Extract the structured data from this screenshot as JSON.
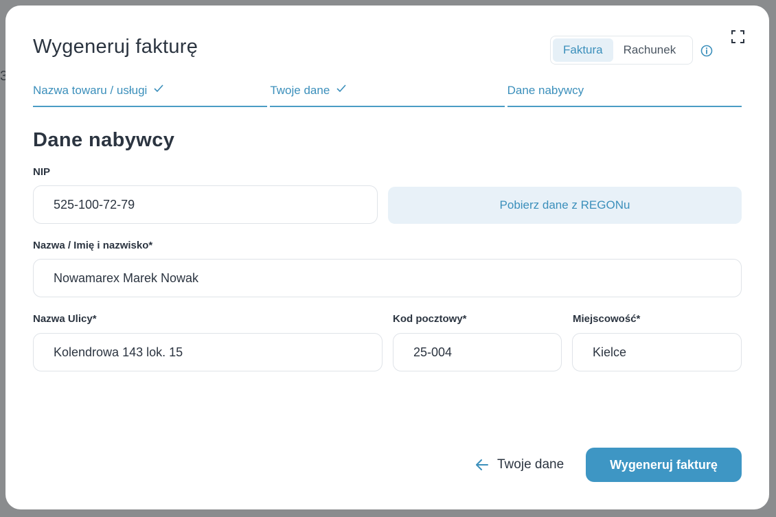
{
  "background": {
    "hint_left_digit": "3"
  },
  "modal": {
    "title": "Wygeneruj fakturę",
    "doc_type": {
      "options": [
        "Faktura",
        "Rachunek"
      ],
      "selected": "Faktura"
    },
    "icons": {
      "info": "info-icon",
      "fullscreen": "fullscreen-icon"
    },
    "steps": [
      {
        "label": "Nazwa towaru / usługi",
        "completed": true
      },
      {
        "label": "Twoje dane",
        "completed": true
      },
      {
        "label": "Dane nabywcy",
        "completed": false
      }
    ],
    "section_title": "Dane nabywcy",
    "form": {
      "nip": {
        "label": "NIP",
        "value": "525-100-72-79"
      },
      "regon_button": "Pobierz dane z REGONu",
      "name": {
        "label": "Nazwa / Imię i nazwisko*",
        "value": "Nowamarex Marek Nowak"
      },
      "street": {
        "label": "Nazwa Ulicy*",
        "value": "Kolendrowa 143 lok. 15"
      },
      "postal_code": {
        "label": "Kod pocztowy*",
        "value": "25-004"
      },
      "city": {
        "label": "Miejscowość*",
        "value": "Kielce"
      }
    },
    "footer": {
      "back_label": "Twoje dane",
      "submit_label": "Wygeneruj fakturę"
    },
    "colors": {
      "accent": "#3e96c4",
      "accent_text": "#3b8fbb",
      "accent_light": "#e8f1f8",
      "heading": "#2b3440",
      "field_border": "#dfe3e8"
    }
  }
}
